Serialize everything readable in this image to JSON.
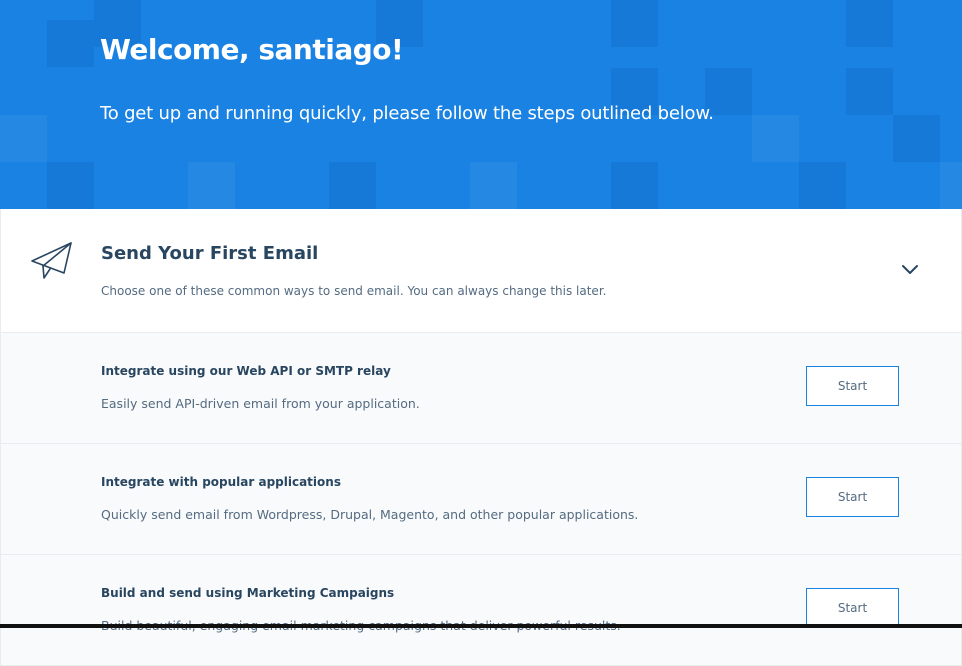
{
  "hero": {
    "title": "Welcome, santiago!",
    "subtitle": "To get up and running quickly, please follow the steps outlined below.",
    "background_color": "#1a82e2"
  },
  "panel": {
    "icon": "paper-plane-icon",
    "title": "Send Your First Email",
    "subtitle": "Choose one of these common ways to send email. You can always change this later.",
    "toggle_icon": "chevron-down-icon"
  },
  "steps": [
    {
      "title": "Integrate using our Web API or SMTP relay",
      "description": "Easily send API-driven email from your application.",
      "button_label": "Start"
    },
    {
      "title": "Integrate with popular applications",
      "description": "Quickly send email from Wordpress, Drupal, Magento, and other popular applications.",
      "button_label": "Start"
    },
    {
      "title": "Build and send using Marketing Campaigns",
      "description": "Build beautiful, engaging email marketing campaigns that deliver powerful results.",
      "button_label": "Start"
    }
  ],
  "colors": {
    "accent": "#1a82e2",
    "text_dark": "#294661",
    "text_muted": "#546b81",
    "row_background": "#f9fafb"
  }
}
